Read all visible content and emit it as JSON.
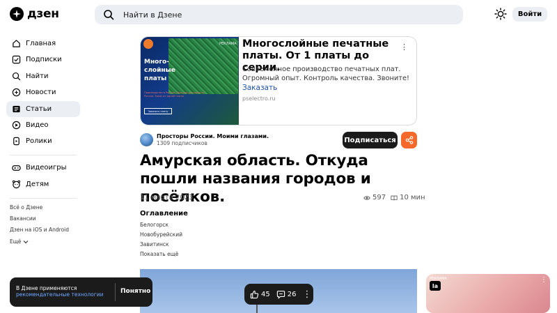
{
  "header": {
    "logo_text": "дзен",
    "search_placeholder": "Найти в Дзене",
    "login_label": "Войти"
  },
  "sidebar": {
    "items": [
      {
        "label": "Главная",
        "icon": "home-icon"
      },
      {
        "label": "Подписки",
        "icon": "subscriptions-icon"
      },
      {
        "label": "Найти",
        "icon": "search-icon"
      },
      {
        "label": "Новости",
        "icon": "news-icon"
      },
      {
        "label": "Статьи",
        "icon": "articles-icon",
        "active": true
      },
      {
        "label": "Видео",
        "icon": "video-icon"
      },
      {
        "label": "Ролики",
        "icon": "shorts-icon"
      },
      {
        "label": "Видеоигры",
        "icon": "gamepad-icon"
      },
      {
        "label": "Детям",
        "icon": "kids-icon"
      }
    ],
    "links": [
      "Всё о Дзене",
      "Вакансии",
      "Дзен на iOS и Android"
    ],
    "more_label": "Ещё"
  },
  "ad": {
    "title": "Многослойные печатные платы. От 1 платы до серии.",
    "description": "Современное производство печатных плат. Огромный опыт. Контроль качества. Звоните!",
    "cta": "Заказать",
    "domain": "pselectro.ru",
    "image_heading": "Много-\nслойные\nплаты",
    "image_subtext": "Производство в России. Быстрая доставка по России. Заказ от одной платы",
    "image_button": "Заказать плату",
    "image_badge": "РЕКЛАМА"
  },
  "channel": {
    "name": "Просторы России. Моими глазами.",
    "subscribers": "1309 подписчиков",
    "subscribe_label": "Подписаться"
  },
  "article": {
    "title": "Амурская область. Откуда пошли названия городов и посёлков.",
    "date": "11 марта 2023",
    "views": "597",
    "read_time": "10 мин",
    "toc_title": "Оглавление",
    "toc_items": [
      "Белогорск",
      "Новобурейский",
      "Завитинск"
    ],
    "toc_more": "Показать ещё"
  },
  "actions": {
    "likes": "45",
    "comments": "26"
  },
  "cookie": {
    "line1": "В Дзене применяются",
    "line2": "рекомендательные технологии",
    "ok_label": "Понятно"
  },
  "right_ad": {
    "badge": "РЕКЛАМА",
    "logo": "la"
  },
  "colors": {
    "accent_orange": "#f56a2b",
    "link_blue": "#1d4fa8",
    "dark_button": "#1b1b1b",
    "surface_gray": "#ebeef2"
  }
}
